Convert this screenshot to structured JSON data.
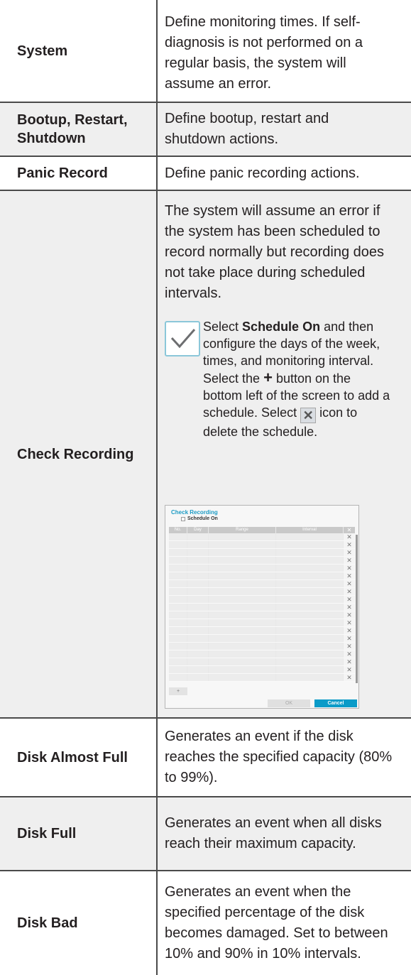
{
  "rows": [
    {
      "label": "System",
      "description": "Define monitoring times. If self-diagnosis is not performed on a regular basis, the system will assume an error."
    },
    {
      "label": "Bootup, Restart, Shutdown",
      "description": "Define bootup, restart and shutdown actions."
    },
    {
      "label": "Panic Record",
      "description": "Define panic recording actions."
    },
    {
      "label": "Check Recording",
      "description": "The system will assume an error if the system has been scheduled to record normally but recording does not take place during scheduled intervals.",
      "note": {
        "select_word": "Select",
        "schedule_on": "Schedule On",
        "text_a": "and then configure the days of the week, times, and monitoring interval. Select the",
        "plus": "+",
        "text_b": "button on the bottom left of the screen to add a schedule. Select",
        "x_glyph": "✕",
        "text_c": "icon to delete the schedule."
      },
      "dialog": {
        "title": "Check Recording",
        "checkbox_label": "Schedule On",
        "columns": [
          "No.",
          "Day",
          "Range",
          "Interval"
        ],
        "delete_glyph": "✕",
        "add_label": "+",
        "ok_label": "OK",
        "cancel_label": "Cancel"
      }
    },
    {
      "label": "Disk Almost Full",
      "description": "Generates an event if the disk reaches the specified capacity (80% to 99%)."
    },
    {
      "label": "Disk Full",
      "description": "Generates an event when all disks reach their maximum capacity."
    },
    {
      "label": "Disk Bad",
      "description": "Generates an event when the specified percentage of the disk becomes damaged. Set to between 10% and 90% in 10% intervals."
    }
  ],
  "colors": {
    "shade": "#efefef",
    "rule": "#4a4a4a",
    "note_border": "#8bc7d9",
    "dialog_accent": "#1c9bc4",
    "cancel_button": "#0a9bc8"
  }
}
